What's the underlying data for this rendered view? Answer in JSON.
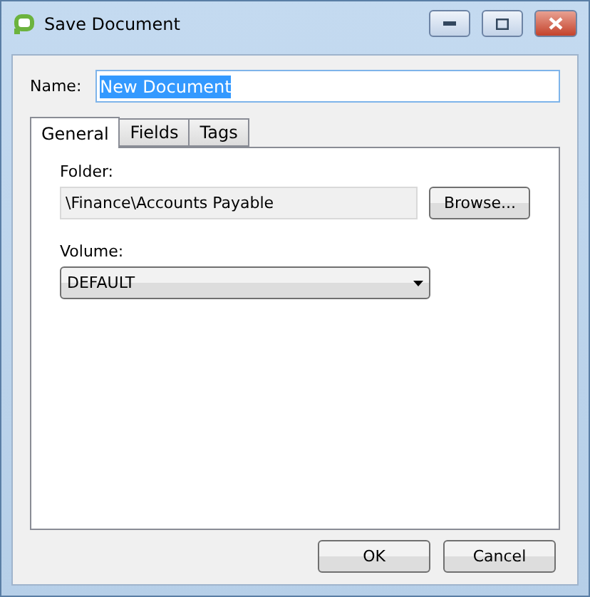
{
  "window": {
    "title": "Save Document"
  },
  "name_field": {
    "label": "Name:",
    "value": "New Document",
    "text_selected": true
  },
  "tabs": [
    {
      "label": "General",
      "selected": true
    },
    {
      "label": "Fields",
      "selected": false
    },
    {
      "label": "Tags",
      "selected": false
    }
  ],
  "general": {
    "folder_label": "Folder:",
    "folder_value": "\\Finance\\Accounts Payable",
    "browse_button": "Browse...",
    "volume_label": "Volume:",
    "volume_value": "DEFAULT"
  },
  "buttons": [
    "OK",
    "Cancel"
  ]
}
